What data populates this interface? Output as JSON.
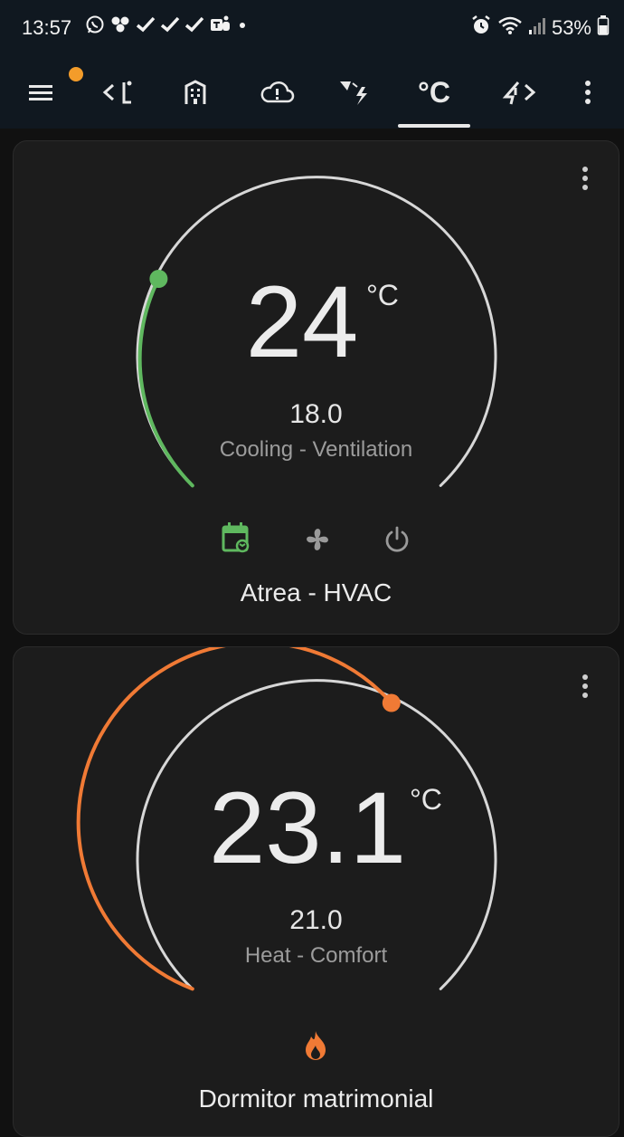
{
  "status_bar": {
    "time": "13:57",
    "battery": "53%",
    "notification_icons": [
      "whatsapp-icon",
      "app-icon",
      "check-icon",
      "check-icon",
      "check-icon",
      "teams-icon",
      "dot-icon"
    ],
    "right_icons": [
      "alarm-icon",
      "wifi-icon",
      "signal-icon",
      "battery-icon"
    ]
  },
  "toolbar": {
    "items": [
      "menu-icon",
      "chevron-left-icon",
      "person-icon",
      "building-icon",
      "cloud-alert-icon",
      "weather-icon",
      "celsius-tab",
      "shower-icon",
      "chevron-right-icon",
      "more-vert-icon"
    ],
    "active_tab_label": "°C",
    "badge_color": "#f39c2a"
  },
  "thermostats": [
    {
      "name": "Atrea - HVAC",
      "current_temp": "24",
      "unit": "°C",
      "target_temp": "18.0",
      "mode_text": "Cooling - Ventilation",
      "accent_color": "#5fb85f",
      "target_fraction": 0.2,
      "action_icons": [
        "calendar-sync-icon",
        "fan-icon",
        "power-icon"
      ]
    },
    {
      "name": "Dormitor matrimonial",
      "current_temp": "23.1",
      "unit": "°C",
      "target_temp": "21.0",
      "mode_text": "Heat - Comfort",
      "accent_color": "#f07a35",
      "target_fraction": 0.57,
      "action_icons": [
        "fire-icon"
      ]
    }
  ]
}
